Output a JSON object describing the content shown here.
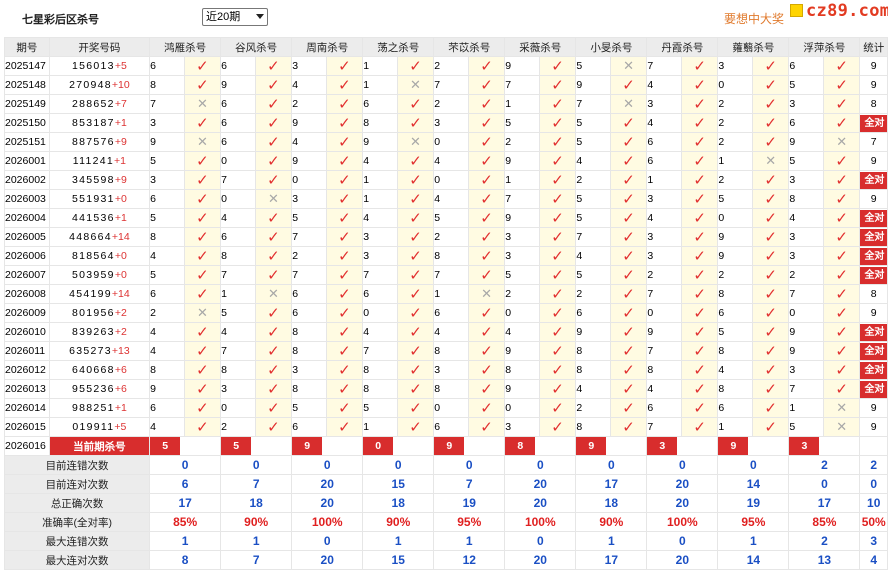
{
  "header": {
    "title": "七星彩后区杀号",
    "period_select": "近20期",
    "promo_text": "要想中大奖",
    "logo_text": "cz89.com"
  },
  "columns": {
    "period": "期号",
    "draw": "开奖号码",
    "experts": [
      "鸿雁杀号",
      "谷风杀号",
      "周南杀号",
      "荡之杀号",
      "芣苡杀号",
      "采薇杀号",
      "小旻杀号",
      "丹霞杀号",
      "蕹蘙杀号",
      "浮萍杀号"
    ],
    "total": "统计"
  },
  "rows": [
    {
      "period": "2025147",
      "main": "156013",
      "extra": "+5",
      "picks": [
        [
          "6",
          "ok"
        ],
        [
          "6",
          "ok"
        ],
        [
          "3",
          "ok"
        ],
        [
          "1",
          "ok"
        ],
        [
          "2",
          "ok"
        ],
        [
          "9",
          "ok"
        ],
        [
          "5",
          "no"
        ],
        [
          "7",
          "ok"
        ],
        [
          "3",
          "ok"
        ],
        [
          "6",
          "ok"
        ]
      ],
      "total": "9"
    },
    {
      "period": "2025148",
      "main": "270948",
      "extra": "+10",
      "picks": [
        [
          "8",
          "ok"
        ],
        [
          "9",
          "ok"
        ],
        [
          "4",
          "ok"
        ],
        [
          "1",
          "no"
        ],
        [
          "7",
          "ok"
        ],
        [
          "7",
          "ok"
        ],
        [
          "9",
          "ok"
        ],
        [
          "4",
          "ok"
        ],
        [
          "0",
          "ok"
        ],
        [
          "5",
          "ok"
        ]
      ],
      "total": "9"
    },
    {
      "period": "2025149",
      "main": "288652",
      "extra": "+7",
      "picks": [
        [
          "7",
          "no"
        ],
        [
          "6",
          "ok"
        ],
        [
          "2",
          "ok"
        ],
        [
          "6",
          "ok"
        ],
        [
          "2",
          "ok"
        ],
        [
          "1",
          "ok"
        ],
        [
          "7",
          "no"
        ],
        [
          "3",
          "ok"
        ],
        [
          "2",
          "ok"
        ],
        [
          "3",
          "ok"
        ]
      ],
      "total": "8"
    },
    {
      "period": "2025150",
      "main": "853187",
      "extra": "+1",
      "picks": [
        [
          "3",
          "ok"
        ],
        [
          "6",
          "ok"
        ],
        [
          "9",
          "ok"
        ],
        [
          "8",
          "ok"
        ],
        [
          "3",
          "ok"
        ],
        [
          "5",
          "ok"
        ],
        [
          "5",
          "ok"
        ],
        [
          "4",
          "ok"
        ],
        [
          "2",
          "ok"
        ],
        [
          "6",
          "ok"
        ]
      ],
      "total": "全对"
    },
    {
      "period": "2025151",
      "main": "887576",
      "extra": "+9",
      "picks": [
        [
          "9",
          "no"
        ],
        [
          "6",
          "ok"
        ],
        [
          "4",
          "ok"
        ],
        [
          "9",
          "no"
        ],
        [
          "0",
          "ok"
        ],
        [
          "2",
          "ok"
        ],
        [
          "5",
          "ok"
        ],
        [
          "6",
          "ok"
        ],
        [
          "2",
          "ok"
        ],
        [
          "9",
          "no"
        ]
      ],
      "total": "7"
    },
    {
      "period": "2026001",
      "main": "111241",
      "extra": "+1",
      "picks": [
        [
          "5",
          "ok"
        ],
        [
          "0",
          "ok"
        ],
        [
          "9",
          "ok"
        ],
        [
          "4",
          "ok"
        ],
        [
          "4",
          "ok"
        ],
        [
          "9",
          "ok"
        ],
        [
          "4",
          "ok"
        ],
        [
          "6",
          "ok"
        ],
        [
          "1",
          "no"
        ],
        [
          "5",
          "ok"
        ]
      ],
      "total": "9"
    },
    {
      "period": "2026002",
      "main": "345598",
      "extra": "+9",
      "picks": [
        [
          "3",
          "ok"
        ],
        [
          "7",
          "ok"
        ],
        [
          "0",
          "ok"
        ],
        [
          "1",
          "ok"
        ],
        [
          "0",
          "ok"
        ],
        [
          "1",
          "ok"
        ],
        [
          "2",
          "ok"
        ],
        [
          "1",
          "ok"
        ],
        [
          "2",
          "ok"
        ],
        [
          "3",
          "ok"
        ]
      ],
      "total": "全对"
    },
    {
      "period": "2026003",
      "main": "551931",
      "extra": "+0",
      "picks": [
        [
          "6",
          "ok"
        ],
        [
          "0",
          "no"
        ],
        [
          "3",
          "ok"
        ],
        [
          "1",
          "ok"
        ],
        [
          "4",
          "ok"
        ],
        [
          "7",
          "ok"
        ],
        [
          "5",
          "ok"
        ],
        [
          "3",
          "ok"
        ],
        [
          "5",
          "ok"
        ],
        [
          "8",
          "ok"
        ]
      ],
      "total": "9"
    },
    {
      "period": "2026004",
      "main": "441536",
      "extra": "+1",
      "picks": [
        [
          "5",
          "ok"
        ],
        [
          "4",
          "ok"
        ],
        [
          "5",
          "ok"
        ],
        [
          "4",
          "ok"
        ],
        [
          "5",
          "ok"
        ],
        [
          "9",
          "ok"
        ],
        [
          "5",
          "ok"
        ],
        [
          "4",
          "ok"
        ],
        [
          "0",
          "ok"
        ],
        [
          "4",
          "ok"
        ]
      ],
      "total": "全对"
    },
    {
      "period": "2026005",
      "main": "448664",
      "extra": "+14",
      "picks": [
        [
          "8",
          "ok"
        ],
        [
          "6",
          "ok"
        ],
        [
          "7",
          "ok"
        ],
        [
          "3",
          "ok"
        ],
        [
          "2",
          "ok"
        ],
        [
          "3",
          "ok"
        ],
        [
          "7",
          "ok"
        ],
        [
          "3",
          "ok"
        ],
        [
          "9",
          "ok"
        ],
        [
          "3",
          "ok"
        ]
      ],
      "total": "全对"
    },
    {
      "period": "2026006",
      "main": "818564",
      "extra": "+0",
      "picks": [
        [
          "4",
          "ok"
        ],
        [
          "8",
          "ok"
        ],
        [
          "2",
          "ok"
        ],
        [
          "3",
          "ok"
        ],
        [
          "8",
          "ok"
        ],
        [
          "3",
          "ok"
        ],
        [
          "4",
          "ok"
        ],
        [
          "3",
          "ok"
        ],
        [
          "9",
          "ok"
        ],
        [
          "3",
          "ok"
        ]
      ],
      "total": "全对"
    },
    {
      "period": "2026007",
      "main": "503959",
      "extra": "+0",
      "picks": [
        [
          "5",
          "ok"
        ],
        [
          "7",
          "ok"
        ],
        [
          "7",
          "ok"
        ],
        [
          "7",
          "ok"
        ],
        [
          "7",
          "ok"
        ],
        [
          "5",
          "ok"
        ],
        [
          "5",
          "ok"
        ],
        [
          "2",
          "ok"
        ],
        [
          "2",
          "ok"
        ],
        [
          "2",
          "ok"
        ]
      ],
      "total": "全对"
    },
    {
      "period": "2026008",
      "main": "454199",
      "extra": "+14",
      "picks": [
        [
          "6",
          "ok"
        ],
        [
          "1",
          "no"
        ],
        [
          "6",
          "ok"
        ],
        [
          "6",
          "ok"
        ],
        [
          "1",
          "no"
        ],
        [
          "2",
          "ok"
        ],
        [
          "2",
          "ok"
        ],
        [
          "7",
          "ok"
        ],
        [
          "8",
          "ok"
        ],
        [
          "7",
          "ok"
        ]
      ],
      "total": "8"
    },
    {
      "period": "2026009",
      "main": "801956",
      "extra": "+2",
      "picks": [
        [
          "2",
          "no"
        ],
        [
          "5",
          "ok"
        ],
        [
          "6",
          "ok"
        ],
        [
          "0",
          "ok"
        ],
        [
          "6",
          "ok"
        ],
        [
          "0",
          "ok"
        ],
        [
          "6",
          "ok"
        ],
        [
          "0",
          "ok"
        ],
        [
          "6",
          "ok"
        ],
        [
          "0",
          "ok"
        ]
      ],
      "total": "9"
    },
    {
      "period": "2026010",
      "main": "839263",
      "extra": "+2",
      "picks": [
        [
          "4",
          "ok"
        ],
        [
          "4",
          "ok"
        ],
        [
          "8",
          "ok"
        ],
        [
          "4",
          "ok"
        ],
        [
          "4",
          "ok"
        ],
        [
          "4",
          "ok"
        ],
        [
          "9",
          "ok"
        ],
        [
          "9",
          "ok"
        ],
        [
          "5",
          "ok"
        ],
        [
          "9",
          "ok"
        ]
      ],
      "total": "全对"
    },
    {
      "period": "2026011",
      "main": "635273",
      "extra": "+13",
      "picks": [
        [
          "4",
          "ok"
        ],
        [
          "7",
          "ok"
        ],
        [
          "8",
          "ok"
        ],
        [
          "7",
          "ok"
        ],
        [
          "8",
          "ok"
        ],
        [
          "9",
          "ok"
        ],
        [
          "8",
          "ok"
        ],
        [
          "7",
          "ok"
        ],
        [
          "8",
          "ok"
        ],
        [
          "9",
          "ok"
        ]
      ],
      "total": "全对"
    },
    {
      "period": "2026012",
      "main": "640668",
      "extra": "+6",
      "picks": [
        [
          "8",
          "ok"
        ],
        [
          "8",
          "ok"
        ],
        [
          "3",
          "ok"
        ],
        [
          "8",
          "ok"
        ],
        [
          "3",
          "ok"
        ],
        [
          "8",
          "ok"
        ],
        [
          "8",
          "ok"
        ],
        [
          "8",
          "ok"
        ],
        [
          "4",
          "ok"
        ],
        [
          "3",
          "ok"
        ]
      ],
      "total": "全对"
    },
    {
      "period": "2026013",
      "main": "955236",
      "extra": "+6",
      "picks": [
        [
          "9",
          "ok"
        ],
        [
          "3",
          "ok"
        ],
        [
          "8",
          "ok"
        ],
        [
          "8",
          "ok"
        ],
        [
          "8",
          "ok"
        ],
        [
          "9",
          "ok"
        ],
        [
          "4",
          "ok"
        ],
        [
          "4",
          "ok"
        ],
        [
          "8",
          "ok"
        ],
        [
          "7",
          "ok"
        ]
      ],
      "total": "全对"
    },
    {
      "period": "2026014",
      "main": "988251",
      "extra": "+1",
      "picks": [
        [
          "6",
          "ok"
        ],
        [
          "0",
          "ok"
        ],
        [
          "5",
          "ok"
        ],
        [
          "5",
          "ok"
        ],
        [
          "0",
          "ok"
        ],
        [
          "0",
          "ok"
        ],
        [
          "2",
          "ok"
        ],
        [
          "6",
          "ok"
        ],
        [
          "6",
          "ok"
        ],
        [
          "1",
          "no"
        ]
      ],
      "total": "9"
    },
    {
      "period": "2026015",
      "main": "019911",
      "extra": "+5",
      "picks": [
        [
          "4",
          "ok"
        ],
        [
          "2",
          "ok"
        ],
        [
          "6",
          "ok"
        ],
        [
          "1",
          "ok"
        ],
        [
          "6",
          "ok"
        ],
        [
          "3",
          "ok"
        ],
        [
          "8",
          "ok"
        ],
        [
          "7",
          "ok"
        ],
        [
          "1",
          "ok"
        ],
        [
          "5",
          "no"
        ]
      ],
      "total": "9"
    }
  ],
  "current": {
    "period": "2026016",
    "label": "当前期杀号",
    "picks": [
      "5",
      "5",
      "9",
      "0",
      "9",
      "8",
      "9",
      "3",
      "9",
      "3"
    ]
  },
  "stats": [
    {
      "label": "目前连错次数",
      "values": [
        "0",
        "0",
        "0",
        "0",
        "0",
        "0",
        "0",
        "0",
        "0",
        "2"
      ],
      "total": "2",
      "red": false
    },
    {
      "label": "目前连对次数",
      "values": [
        "6",
        "7",
        "20",
        "15",
        "7",
        "20",
        "17",
        "20",
        "14",
        "0"
      ],
      "total": "0",
      "red": false
    },
    {
      "label": "总正确次数",
      "values": [
        "17",
        "18",
        "20",
        "18",
        "19",
        "20",
        "18",
        "20",
        "19",
        "17"
      ],
      "total": "10",
      "red": false
    },
    {
      "label": "准确率(全对率)",
      "values": [
        "85%",
        "90%",
        "100%",
        "90%",
        "95%",
        "100%",
        "90%",
        "100%",
        "95%",
        "85%"
      ],
      "total": "50%",
      "red": true
    },
    {
      "label": "最大连错次数",
      "values": [
        "1",
        "1",
        "0",
        "1",
        "1",
        "0",
        "1",
        "0",
        "1",
        "2"
      ],
      "total": "3",
      "red": false
    },
    {
      "label": "最大连对次数",
      "values": [
        "8",
        "7",
        "20",
        "15",
        "12",
        "20",
        "17",
        "20",
        "14",
        "13"
      ],
      "total": "4",
      "red": false
    }
  ],
  "colors": {
    "accent_red": "#d82d2d",
    "stat_blue": "#1a4fc4",
    "promo_orange": "#e07a2d",
    "mark_bg": "#fffbe2"
  },
  "icons": {
    "ok": "check-icon",
    "no": "cross-icon"
  }
}
